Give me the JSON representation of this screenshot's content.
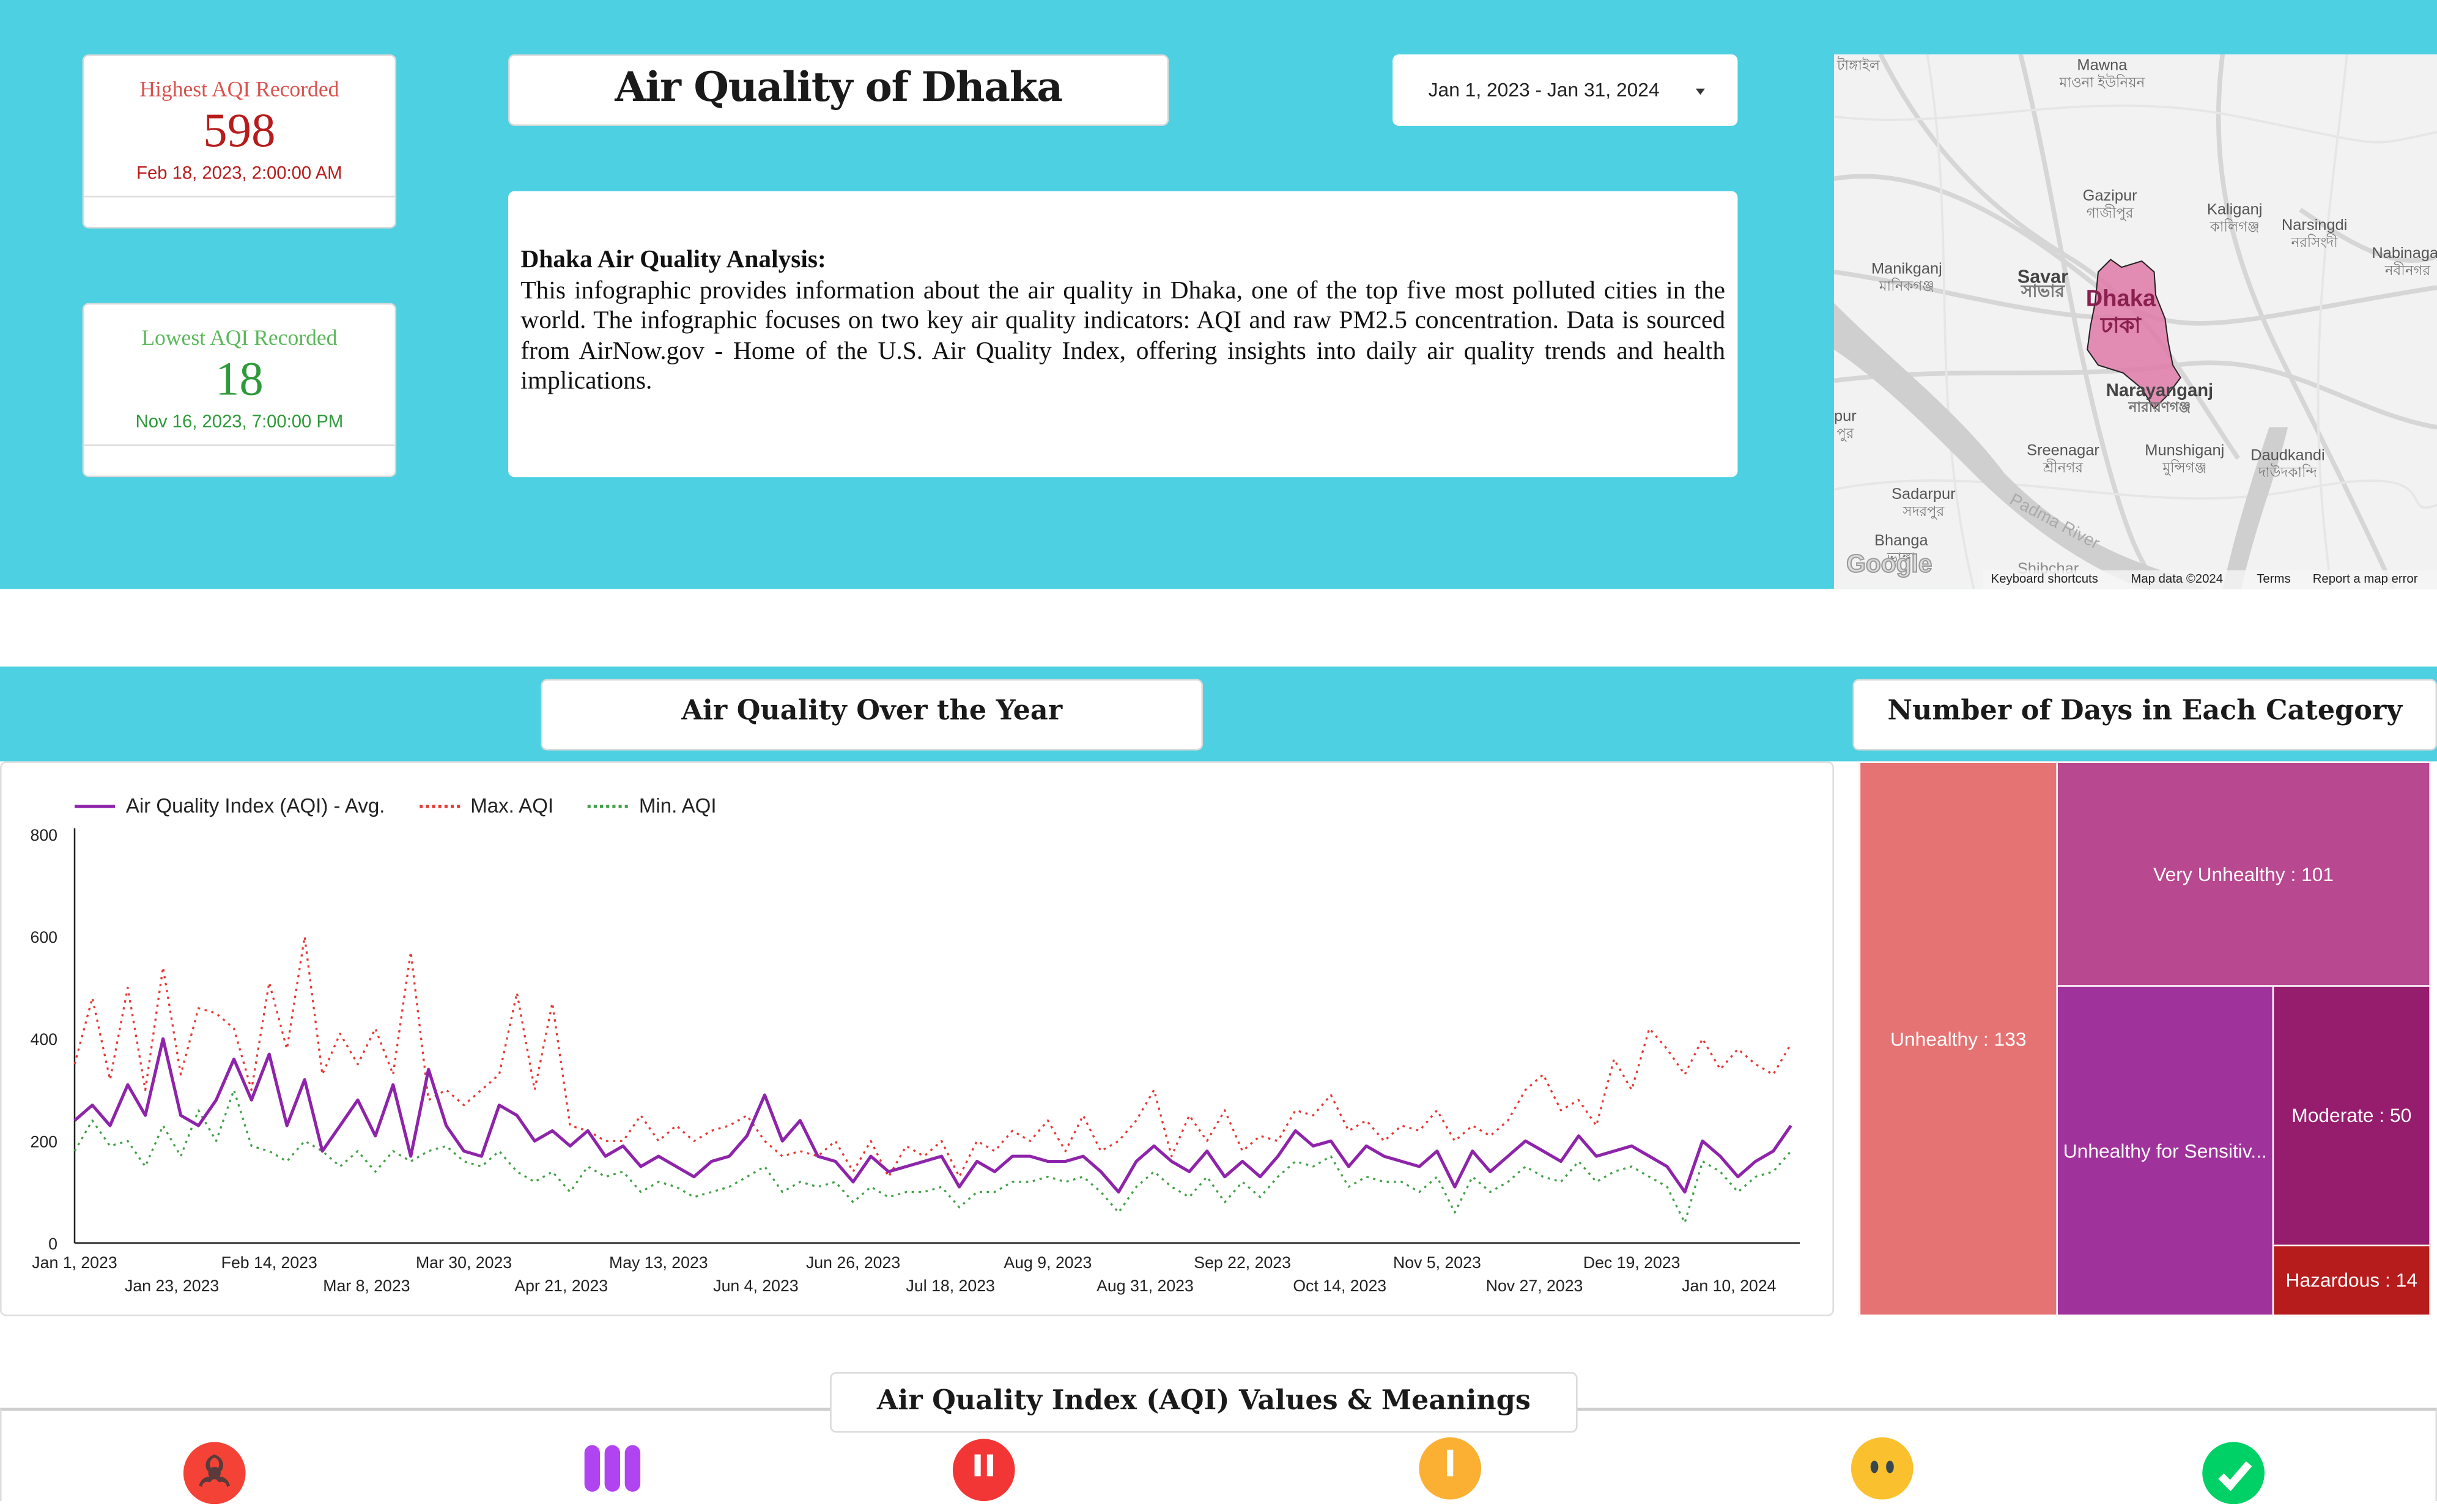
{
  "kpis": {
    "highest": {
      "label": "Highest AQI Recorded",
      "value": "598",
      "date": "Feb 18, 2023, 2:00:00 AM",
      "label_color": "#d9534f",
      "value_color": "#b71c1c"
    },
    "lowest": {
      "label": "Lowest AQI Recorded",
      "value": "18",
      "date": "Nov 16, 2023, 7:00:00 PM",
      "label_color": "#5cb85c",
      "value_color": "#2e9a3a"
    }
  },
  "header": {
    "title": "Air Quality of Dhaka",
    "date_range": "Jan 1, 2023 - Jan 31, 2024",
    "dropdown_icon": "caret-down-icon"
  },
  "description": {
    "heading": "Dhaka Air Quality Analysis:",
    "body": "This infographic provides information about the air quality in Dhaka, one of the top five most polluted cities in the world. The infographic focuses on two key air quality indicators: AQI and raw PM2.5 concentration. Data is sourced from AirNow.gov - Home of the U.S. Air Quality Index, offering insights into daily air quality trends and health implications."
  },
  "map": {
    "places": [
      {
        "en": "",
        "bn": "টাঙ্গাইল"
      },
      {
        "en": "Mawna",
        "bn": "মাওনা ইউনিয়ন"
      },
      {
        "en": "Gazipur",
        "bn": "গাজীপুর"
      },
      {
        "en": "Kaliganj",
        "bn": "কালিগঞ্জ"
      },
      {
        "en": "Narsingdi",
        "bn": "নরসিংদী"
      },
      {
        "en": "Nabinagar",
        "bn": "নবীনগর"
      },
      {
        "en": "Manikganj",
        "bn": "মানিকগঞ্জ"
      },
      {
        "en": "Savar",
        "bn": "সাভার"
      },
      {
        "en": "Dhaka",
        "bn": "ঢাকা"
      },
      {
        "en": "Narayanganj",
        "bn": "নারায়ণগঞ্জ"
      },
      {
        "en": "Sreenagar",
        "bn": "শ্রীনগর"
      },
      {
        "en": "Munshiganj",
        "bn": "মুন্সিগঞ্জ"
      },
      {
        "en": "Daudkandi",
        "bn": "দাউদকান্দি"
      },
      {
        "en": "Sadarpur",
        "bn": "সদরপুর"
      },
      {
        "en": "Bhanga",
        "bn": "ভাঙ্গা"
      },
      {
        "en": "pur",
        "bn": "পুর"
      },
      {
        "en": "Shibchar",
        "bn": ""
      },
      {
        "en": "Padma River",
        "bn": ""
      }
    ],
    "logo": "Google",
    "footer": [
      "Keyboard shortcuts",
      "Map data ©2024",
      "Terms",
      "Report a map error"
    ],
    "highlight_color": "#e07aa8"
  },
  "sections": {
    "line_chart_title": "Air Quality Over the Year",
    "treemap_title": "Number of Days in Each Category",
    "aqi_meanings_title": "Air Quality Index (AQI) Values & Meanings"
  },
  "aqi_icons": [
    {
      "name": "biohazard-icon",
      "color": "#f44336"
    },
    {
      "name": "purple-exclamation-icon",
      "color": "#b044f0"
    },
    {
      "name": "double-exclamation-icon",
      "color": "#f23636"
    },
    {
      "name": "exclamation-icon",
      "color": "#fbb034"
    },
    {
      "name": "neutral-face-icon",
      "color": "#fbc02d"
    },
    {
      "name": "checkmark-icon",
      "color": "#00d166"
    }
  ],
  "colors": {
    "band": "#4dd0e1",
    "avg_line": "#8e24aa",
    "max_line": "#e53935",
    "min_line": "#43a047"
  },
  "chart_data": [
    {
      "type": "line",
      "title": "Air Quality Over the Year",
      "xlabel": "",
      "ylabel": "",
      "ylim": [
        0,
        800
      ],
      "yticks": [
        0,
        200,
        400,
        600,
        800
      ],
      "grid": false,
      "legend_position": "top-left",
      "x_start": "Jan 1, 2023",
      "x_tick_labels_row1": [
        "Jan 1, 2023",
        "Feb 14, 2023",
        "Mar 30, 2023",
        "May 13, 2023",
        "Jun 26, 2023",
        "Aug 9, 2023",
        "Sep 22, 2023",
        "Nov 5, 2023",
        "Dec 19, 2023"
      ],
      "x_tick_labels_row2": [
        "Jan 23, 2023",
        "Mar 8, 2023",
        "Apr 21, 2023",
        "Jun 4, 2023",
        "Jul 18, 2023",
        "Aug 31, 2023",
        "Oct 14, 2023",
        "Nov 27, 2023",
        "Jan 10, 2024"
      ],
      "x_tick_days_row1": [
        0,
        44,
        88,
        132,
        176,
        220,
        264,
        308,
        352
      ],
      "x_tick_days_row2": [
        22,
        66,
        110,
        154,
        198,
        242,
        286,
        330,
        374
      ],
      "x_days_total": 390,
      "sample_days": [
        0,
        4,
        8,
        12,
        16,
        20,
        24,
        28,
        32,
        36,
        40,
        44,
        48,
        52,
        56,
        60,
        64,
        68,
        72,
        76,
        80,
        84,
        88,
        92,
        96,
        100,
        104,
        108,
        112,
        116,
        120,
        124,
        128,
        132,
        136,
        140,
        144,
        148,
        152,
        156,
        160,
        164,
        168,
        172,
        176,
        180,
        184,
        188,
        192,
        196,
        200,
        204,
        208,
        212,
        216,
        220,
        224,
        228,
        232,
        236,
        240,
        244,
        248,
        252,
        256,
        260,
        264,
        268,
        272,
        276,
        280,
        284,
        288,
        292,
        296,
        300,
        304,
        308,
        312,
        316,
        320,
        324,
        328,
        332,
        336,
        340,
        344,
        348,
        352,
        356,
        360,
        364,
        368,
        372,
        376,
        380,
        384,
        388
      ],
      "series": [
        {
          "name": "Air Quality Index (AQI) - Avg.",
          "style": "solid",
          "values": [
            240,
            270,
            230,
            310,
            250,
            400,
            250,
            230,
            280,
            360,
            280,
            370,
            230,
            320,
            180,
            230,
            280,
            210,
            310,
            170,
            340,
            230,
            180,
            170,
            270,
            250,
            200,
            220,
            190,
            220,
            170,
            190,
            150,
            170,
            150,
            130,
            160,
            170,
            210,
            290,
            200,
            240,
            170,
            160,
            120,
            170,
            140,
            150,
            160,
            170,
            110,
            160,
            140,
            170,
            170,
            160,
            160,
            170,
            140,
            100,
            160,
            190,
            160,
            140,
            180,
            130,
            160,
            130,
            170,
            220,
            190,
            200,
            150,
            190,
            170,
            160,
            150,
            180,
            110,
            180,
            140,
            170,
            200,
            180,
            160,
            210,
            170,
            180,
            190,
            170,
            150,
            100,
            200,
            170,
            130,
            160,
            180,
            230
          ]
        },
        {
          "name": "Max. AQI",
          "style": "dotted",
          "values": [
            350,
            480,
            320,
            500,
            300,
            540,
            330,
            460,
            450,
            420,
            300,
            510,
            380,
            600,
            330,
            410,
            350,
            420,
            330,
            570,
            280,
            300,
            270,
            300,
            330,
            490,
            300,
            470,
            230,
            220,
            200,
            200,
            250,
            200,
            230,
            200,
            220,
            230,
            250,
            200,
            170,
            180,
            170,
            200,
            140,
            200,
            130,
            190,
            170,
            200,
            130,
            200,
            180,
            220,
            200,
            240,
            180,
            250,
            180,
            200,
            240,
            300,
            170,
            250,
            200,
            260,
            180,
            210,
            200,
            260,
            250,
            290,
            220,
            240,
            200,
            230,
            220,
            260,
            200,
            230,
            210,
            240,
            300,
            330,
            260,
            280,
            230,
            360,
            300,
            420,
            380,
            330,
            400,
            340,
            380,
            350,
            330,
            390
          ]
        },
        {
          "name": "Min. AQI",
          "style": "dotted",
          "values": [
            180,
            240,
            190,
            200,
            150,
            230,
            170,
            260,
            200,
            300,
            190,
            180,
            160,
            200,
            180,
            150,
            180,
            140,
            180,
            160,
            180,
            190,
            160,
            150,
            180,
            140,
            120,
            140,
            100,
            150,
            130,
            140,
            100,
            120,
            110,
            90,
            100,
            110,
            130,
            150,
            100,
            120,
            110,
            120,
            80,
            110,
            90,
            100,
            100,
            110,
            70,
            100,
            100,
            120,
            120,
            130,
            120,
            130,
            100,
            60,
            110,
            140,
            110,
            90,
            130,
            80,
            120,
            90,
            130,
            160,
            150,
            170,
            110,
            130,
            120,
            120,
            100,
            130,
            60,
            130,
            100,
            120,
            150,
            130,
            120,
            160,
            120,
            140,
            150,
            130,
            110,
            40,
            160,
            140,
            100,
            130,
            140,
            180
          ]
        }
      ]
    },
    {
      "type": "treemap",
      "title": "Number of Days in Each Category",
      "categories": [
        "Unhealthy",
        "Very Unhealthy",
        "Unhealthy for Sensitive Groups",
        "Moderate",
        "Hazardous"
      ],
      "values": [
        133,
        101,
        90,
        50,
        14
      ],
      "labels": [
        "Unhealthy : 133",
        "Very Unhealthy : 101",
        "Unhealthy for Sensitiv...",
        "Moderate : 50",
        "Hazardous : 14"
      ],
      "colors": [
        "#e57373",
        "#b8488f",
        "#a0329c",
        "#961d6e",
        "#b71c1c"
      ]
    }
  ]
}
